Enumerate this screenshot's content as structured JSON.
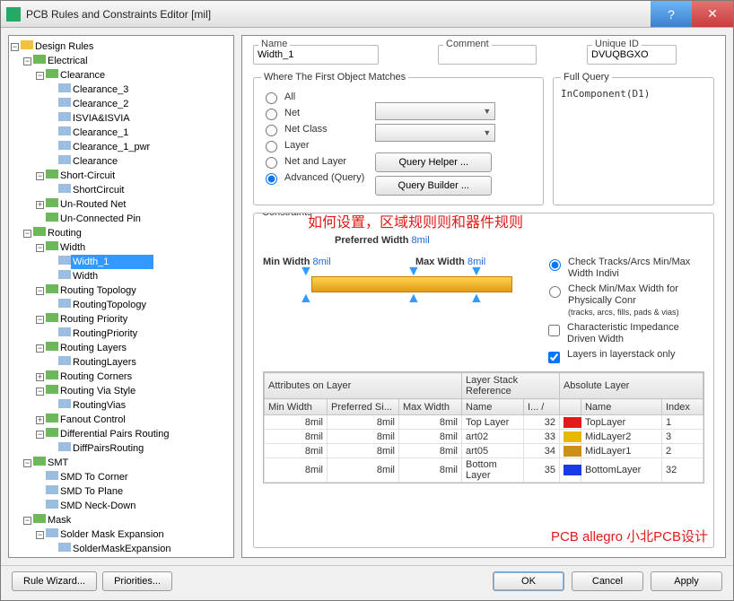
{
  "window": {
    "title": "PCB Rules and Constraints Editor [mil]"
  },
  "tree": {
    "root": "Design Rules",
    "electrical": "Electrical",
    "clearance": "Clearance",
    "clearance_3": "Clearance_3",
    "clearance_2": "Clearance_2",
    "isvia_isvia": "ISVIA&ISVIA",
    "clearance_1": "Clearance_1",
    "clearance_1_pwr": "Clearance_1_pwr",
    "clearance_leaf": "Clearance",
    "short_circuit": "Short-Circuit",
    "short_circuit_leaf": "ShortCircuit",
    "unrouted_net": "Un-Routed Net",
    "unconnected_pin": "Un-Connected Pin",
    "routing": "Routing",
    "width": "Width",
    "width_1": "Width_1",
    "width_leaf": "Width",
    "routing_topology": "Routing Topology",
    "routing_topology_leaf": "RoutingTopology",
    "routing_priority": "Routing Priority",
    "routing_priority_leaf": "RoutingPriority",
    "routing_layers": "Routing Layers",
    "routing_layers_leaf": "RoutingLayers",
    "routing_corners": "Routing Corners",
    "routing_via_style": "Routing Via Style",
    "routing_vias_leaf": "RoutingVias",
    "fanout_control": "Fanout Control",
    "diff_pairs_routing": "Differential Pairs Routing",
    "diff_pairs_routing_leaf": "DiffPairsRouting",
    "smt": "SMT",
    "smd_corner": "SMD To Corner",
    "smd_plane": "SMD To Plane",
    "smd_neck": "SMD Neck-Down",
    "mask": "Mask",
    "solder_mask_expansion": "Solder Mask Expansion",
    "solder_mask_expansion_leaf": "SolderMaskExpansion"
  },
  "namefield": {
    "label": "Name",
    "value": "Width_1"
  },
  "comment": {
    "label": "Comment",
    "value": ""
  },
  "uniqueid": {
    "label": "Unique ID",
    "value": "DVUQBGXO"
  },
  "where": {
    "legend": "Where The First Object Matches",
    "opts": {
      "all": "All",
      "net": "Net",
      "netclass": "Net Class",
      "layer": "Layer",
      "netlayer": "Net and Layer",
      "adv": "Advanced (Query)"
    },
    "query_helper": "Query Helper ...",
    "query_builder": "Query Builder ..."
  },
  "fullquery": {
    "legend": "Full Query",
    "value": "InComponent(D1)"
  },
  "constraints": {
    "legend": "Constraints",
    "annot_top": "如何设置，区域规则则和器件规则",
    "preferred_label": "Preferred Width",
    "preferred_val": "8mil",
    "min_label": "Min Width",
    "min_val": "8mil",
    "max_label": "Max Width",
    "max_val": "8mil",
    "check1": "Check Tracks/Arcs Min/Max Width Indivi",
    "check2": "Check Min/Max Width for Physically Conr",
    "check2_sub": "(tracks, arcs, fills, pads & vias)",
    "check3": "Characteristic Impedance Driven Width",
    "check4": "Layers in layerstack only"
  },
  "grid": {
    "hdr_attr": "Attributes on Layer",
    "hdr_layer": "Layer Stack Reference",
    "hdr_abs": "Absolute Layer",
    "cols": {
      "min": "Min Width",
      "pref": "Preferred Si...",
      "max": "Max Width",
      "name": "Name",
      "idx": "I... /",
      "name2": "Name",
      "index": "Index"
    },
    "rows": [
      {
        "min": "8mil",
        "pref": "8mil",
        "max": "8mil",
        "name": "Top Layer",
        "idx": "32",
        "color": "#e21a1a",
        "name2": "TopLayer",
        "index": "1"
      },
      {
        "min": "8mil",
        "pref": "8mil",
        "max": "8mil",
        "name": "art02",
        "idx": "33",
        "color": "#e6b800",
        "name2": "MidLayer2",
        "index": "3"
      },
      {
        "min": "8mil",
        "pref": "8mil",
        "max": "8mil",
        "name": "art05",
        "idx": "34",
        "color": "#cc8f1a",
        "name2": "MidLayer1",
        "index": "2"
      },
      {
        "min": "8mil",
        "pref": "8mil",
        "max": "8mil",
        "name": "Bottom Layer",
        "idx": "35",
        "color": "#1a3ae6",
        "name2": "BottomLayer",
        "index": "32"
      }
    ]
  },
  "watermark": "PCB allegro 小北PCB设计",
  "buttons": {
    "rule_wizard": "Rule Wizard...",
    "priorities": "Priorities...",
    "ok": "OK",
    "cancel": "Cancel",
    "apply": "Apply"
  }
}
